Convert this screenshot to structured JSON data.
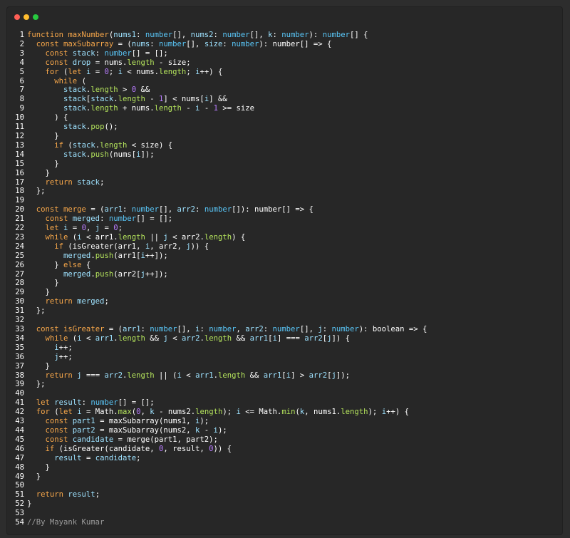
{
  "colors": {
    "background": "#2d2d2d",
    "editor_background": "#272727",
    "dot_red": "#ff5f56",
    "dot_yellow": "#ffbd2e",
    "dot_green": "#27c93f",
    "keyword": "#f7a74a",
    "type": "#59c6f7",
    "variable": "#9ee2ff",
    "number": "#b87cff",
    "property": "#b4e35c",
    "comment": "#9b9b9b",
    "plain": "#ffffff"
  },
  "window_controls": [
    "close-dot",
    "minimize-dot",
    "maximize-dot"
  ],
  "code": {
    "lines": [
      [
        [
          "kw",
          "function "
        ],
        [
          "fn",
          "maxNumber"
        ],
        [
          "p",
          "("
        ],
        [
          "var",
          "nums1"
        ],
        [
          "p",
          ": "
        ],
        [
          "ty",
          "number"
        ],
        [
          "p",
          "[], "
        ],
        [
          "var",
          "nums2"
        ],
        [
          "p",
          ": "
        ],
        [
          "ty",
          "number"
        ],
        [
          "p",
          "[], "
        ],
        [
          "var",
          "k"
        ],
        [
          "p",
          ": "
        ],
        [
          "ty",
          "number"
        ],
        [
          "p",
          "): "
        ],
        [
          "ty",
          "number"
        ],
        [
          "p",
          "[] {"
        ]
      ],
      [
        [
          "p",
          "  "
        ],
        [
          "kw",
          "const "
        ],
        [
          "fn",
          "maxSubarray"
        ],
        [
          "p",
          " = ("
        ],
        [
          "var",
          "nums"
        ],
        [
          "p",
          ": "
        ],
        [
          "ty",
          "number"
        ],
        [
          "p",
          "[], "
        ],
        [
          "var",
          "size"
        ],
        [
          "p",
          ": "
        ],
        [
          "ty",
          "number"
        ],
        [
          "p",
          "): number[] => {"
        ]
      ],
      [
        [
          "p",
          "    "
        ],
        [
          "kw",
          "const "
        ],
        [
          "var",
          "stack"
        ],
        [
          "p",
          ": "
        ],
        [
          "ty",
          "number"
        ],
        [
          "p",
          "[] = [];"
        ]
      ],
      [
        [
          "p",
          "    "
        ],
        [
          "kw",
          "const "
        ],
        [
          "var",
          "drop"
        ],
        [
          "p",
          " = nums."
        ],
        [
          "prop",
          "length"
        ],
        [
          "p",
          " - size;"
        ]
      ],
      [
        [
          "p",
          "    "
        ],
        [
          "kw",
          "for "
        ],
        [
          "p",
          "("
        ],
        [
          "kw",
          "let "
        ],
        [
          "var",
          "i"
        ],
        [
          "p",
          " = "
        ],
        [
          "num",
          "0"
        ],
        [
          "p",
          "; "
        ],
        [
          "var",
          "i"
        ],
        [
          "p",
          " < nums."
        ],
        [
          "prop",
          "length"
        ],
        [
          "p",
          "; "
        ],
        [
          "var",
          "i"
        ],
        [
          "p",
          "++) {"
        ]
      ],
      [
        [
          "p",
          "      "
        ],
        [
          "kw",
          "while "
        ],
        [
          "p",
          "("
        ]
      ],
      [
        [
          "p",
          "        "
        ],
        [
          "var",
          "stack"
        ],
        [
          "p",
          "."
        ],
        [
          "prop",
          "length"
        ],
        [
          "p",
          " > "
        ],
        [
          "num",
          "0"
        ],
        [
          "p",
          " &&"
        ]
      ],
      [
        [
          "p",
          "        "
        ],
        [
          "var",
          "stack"
        ],
        [
          "p",
          "["
        ],
        [
          "var",
          "stack"
        ],
        [
          "p",
          "."
        ],
        [
          "prop",
          "length"
        ],
        [
          "p",
          " - "
        ],
        [
          "num",
          "1"
        ],
        [
          "p",
          "] < nums["
        ],
        [
          "var",
          "i"
        ],
        [
          "p",
          "] &&"
        ]
      ],
      [
        [
          "p",
          "        "
        ],
        [
          "var",
          "stack"
        ],
        [
          "p",
          "."
        ],
        [
          "prop",
          "length"
        ],
        [
          "p",
          " + nums."
        ],
        [
          "prop",
          "length"
        ],
        [
          "p",
          " - "
        ],
        [
          "var",
          "i"
        ],
        [
          "p",
          " - "
        ],
        [
          "num",
          "1"
        ],
        [
          "p",
          " >= size"
        ]
      ],
      [
        [
          "p",
          "      ) {"
        ]
      ],
      [
        [
          "p",
          "        "
        ],
        [
          "var",
          "stack"
        ],
        [
          "p",
          "."
        ],
        [
          "mth",
          "pop"
        ],
        [
          "p",
          "();"
        ]
      ],
      [
        [
          "p",
          "      }"
        ]
      ],
      [
        [
          "p",
          "      "
        ],
        [
          "kw",
          "if "
        ],
        [
          "p",
          "("
        ],
        [
          "var",
          "stack"
        ],
        [
          "p",
          "."
        ],
        [
          "prop",
          "length"
        ],
        [
          "p",
          " < size) {"
        ]
      ],
      [
        [
          "p",
          "        "
        ],
        [
          "var",
          "stack"
        ],
        [
          "p",
          "."
        ],
        [
          "mth",
          "push"
        ],
        [
          "p",
          "(nums["
        ],
        [
          "var",
          "i"
        ],
        [
          "p",
          "]);"
        ]
      ],
      [
        [
          "p",
          "      }"
        ]
      ],
      [
        [
          "p",
          "    }"
        ]
      ],
      [
        [
          "p",
          "    "
        ],
        [
          "kw",
          "return "
        ],
        [
          "var",
          "stack"
        ],
        [
          "p",
          ";"
        ]
      ],
      [
        [
          "p",
          "  };"
        ]
      ],
      [
        [
          "p",
          ""
        ]
      ],
      [
        [
          "p",
          "  "
        ],
        [
          "kw",
          "const "
        ],
        [
          "fn",
          "merge"
        ],
        [
          "p",
          " = ("
        ],
        [
          "var",
          "arr1"
        ],
        [
          "p",
          ": "
        ],
        [
          "ty",
          "number"
        ],
        [
          "p",
          "[], "
        ],
        [
          "var",
          "arr2"
        ],
        [
          "p",
          ": "
        ],
        [
          "ty",
          "number"
        ],
        [
          "p",
          "[]): number[] => {"
        ]
      ],
      [
        [
          "p",
          "    "
        ],
        [
          "kw",
          "const "
        ],
        [
          "var",
          "merged"
        ],
        [
          "p",
          ": "
        ],
        [
          "ty",
          "number"
        ],
        [
          "p",
          "[] = [];"
        ]
      ],
      [
        [
          "p",
          "    "
        ],
        [
          "kw",
          "let "
        ],
        [
          "var",
          "i"
        ],
        [
          "p",
          " = "
        ],
        [
          "num",
          "0"
        ],
        [
          "p",
          ", "
        ],
        [
          "var",
          "j"
        ],
        [
          "p",
          " = "
        ],
        [
          "num",
          "0"
        ],
        [
          "p",
          ";"
        ]
      ],
      [
        [
          "p",
          "    "
        ],
        [
          "kw",
          "while "
        ],
        [
          "p",
          "("
        ],
        [
          "var",
          "i"
        ],
        [
          "p",
          " < arr1."
        ],
        [
          "prop",
          "length"
        ],
        [
          "p",
          " || "
        ],
        [
          "var",
          "j"
        ],
        [
          "p",
          " < arr2."
        ],
        [
          "prop",
          "length"
        ],
        [
          "p",
          ") {"
        ]
      ],
      [
        [
          "p",
          "      "
        ],
        [
          "kw",
          "if "
        ],
        [
          "p",
          "(isGreater(arr1, "
        ],
        [
          "var",
          "i"
        ],
        [
          "p",
          ", arr2, "
        ],
        [
          "var",
          "j"
        ],
        [
          "p",
          ")) {"
        ]
      ],
      [
        [
          "p",
          "        "
        ],
        [
          "var",
          "merged"
        ],
        [
          "p",
          "."
        ],
        [
          "mth",
          "push"
        ],
        [
          "p",
          "(arr1["
        ],
        [
          "var",
          "i"
        ],
        [
          "p",
          "++]);"
        ]
      ],
      [
        [
          "p",
          "      } "
        ],
        [
          "kw",
          "else "
        ],
        [
          "p",
          "{"
        ]
      ],
      [
        [
          "p",
          "        "
        ],
        [
          "var",
          "merged"
        ],
        [
          "p",
          "."
        ],
        [
          "mth",
          "push"
        ],
        [
          "p",
          "(arr2["
        ],
        [
          "var",
          "j"
        ],
        [
          "p",
          "++]);"
        ]
      ],
      [
        [
          "p",
          "      }"
        ]
      ],
      [
        [
          "p",
          "    }"
        ]
      ],
      [
        [
          "p",
          "    "
        ],
        [
          "kw",
          "return "
        ],
        [
          "var",
          "merged"
        ],
        [
          "p",
          ";"
        ]
      ],
      [
        [
          "p",
          "  };"
        ]
      ],
      [
        [
          "p",
          ""
        ]
      ],
      [
        [
          "p",
          "  "
        ],
        [
          "kw",
          "const "
        ],
        [
          "fn",
          "isGreater"
        ],
        [
          "p",
          " = ("
        ],
        [
          "var",
          "arr1"
        ],
        [
          "p",
          ": "
        ],
        [
          "ty",
          "number"
        ],
        [
          "p",
          "[], "
        ],
        [
          "var",
          "i"
        ],
        [
          "p",
          ": "
        ],
        [
          "ty",
          "number"
        ],
        [
          "p",
          ", "
        ],
        [
          "var",
          "arr2"
        ],
        [
          "p",
          ": "
        ],
        [
          "ty",
          "number"
        ],
        [
          "p",
          "[], "
        ],
        [
          "var",
          "j"
        ],
        [
          "p",
          ": "
        ],
        [
          "ty",
          "number"
        ],
        [
          "p",
          "): boolean => {"
        ]
      ],
      [
        [
          "p",
          "    "
        ],
        [
          "kw",
          "while "
        ],
        [
          "p",
          "("
        ],
        [
          "var",
          "i"
        ],
        [
          "p",
          " < "
        ],
        [
          "var",
          "arr1"
        ],
        [
          "p",
          "."
        ],
        [
          "prop",
          "length"
        ],
        [
          "p",
          " && "
        ],
        [
          "var",
          "j"
        ],
        [
          "p",
          " < "
        ],
        [
          "var",
          "arr2"
        ],
        [
          "p",
          "."
        ],
        [
          "prop",
          "length"
        ],
        [
          "p",
          " && "
        ],
        [
          "var",
          "arr1"
        ],
        [
          "p",
          "["
        ],
        [
          "var",
          "i"
        ],
        [
          "p",
          "] === "
        ],
        [
          "var",
          "arr2"
        ],
        [
          "p",
          "["
        ],
        [
          "var",
          "j"
        ],
        [
          "p",
          "]) {"
        ]
      ],
      [
        [
          "p",
          "      "
        ],
        [
          "var",
          "i"
        ],
        [
          "p",
          "++;"
        ]
      ],
      [
        [
          "p",
          "      "
        ],
        [
          "var",
          "j"
        ],
        [
          "p",
          "++;"
        ]
      ],
      [
        [
          "p",
          "    }"
        ]
      ],
      [
        [
          "p",
          "    "
        ],
        [
          "kw",
          "return "
        ],
        [
          "var",
          "j"
        ],
        [
          "p",
          " === "
        ],
        [
          "var",
          "arr2"
        ],
        [
          "p",
          "."
        ],
        [
          "prop",
          "length"
        ],
        [
          "p",
          " || ("
        ],
        [
          "var",
          "i"
        ],
        [
          "p",
          " < "
        ],
        [
          "var",
          "arr1"
        ],
        [
          "p",
          "."
        ],
        [
          "prop",
          "length"
        ],
        [
          "p",
          " && "
        ],
        [
          "var",
          "arr1"
        ],
        [
          "p",
          "["
        ],
        [
          "var",
          "i"
        ],
        [
          "p",
          "] > "
        ],
        [
          "var",
          "arr2"
        ],
        [
          "p",
          "["
        ],
        [
          "var",
          "j"
        ],
        [
          "p",
          "]);"
        ]
      ],
      [
        [
          "p",
          "  };"
        ]
      ],
      [
        [
          "p",
          ""
        ]
      ],
      [
        [
          "p",
          "  "
        ],
        [
          "kw",
          "let "
        ],
        [
          "var",
          "result"
        ],
        [
          "p",
          ": "
        ],
        [
          "ty",
          "number"
        ],
        [
          "p",
          "[] = [];"
        ]
      ],
      [
        [
          "p",
          "  "
        ],
        [
          "kw",
          "for "
        ],
        [
          "p",
          "("
        ],
        [
          "kw",
          "let "
        ],
        [
          "var",
          "i"
        ],
        [
          "p",
          " = Math."
        ],
        [
          "mth",
          "max"
        ],
        [
          "p",
          "("
        ],
        [
          "num",
          "0"
        ],
        [
          "p",
          ", "
        ],
        [
          "var",
          "k"
        ],
        [
          "p",
          " - nums2."
        ],
        [
          "prop",
          "length"
        ],
        [
          "p",
          "); "
        ],
        [
          "var",
          "i"
        ],
        [
          "p",
          " <= Math."
        ],
        [
          "mth",
          "min"
        ],
        [
          "p",
          "("
        ],
        [
          "var",
          "k"
        ],
        [
          "p",
          ", nums1."
        ],
        [
          "prop",
          "length"
        ],
        [
          "p",
          "); "
        ],
        [
          "var",
          "i"
        ],
        [
          "p",
          "++) {"
        ]
      ],
      [
        [
          "p",
          "    "
        ],
        [
          "kw",
          "const "
        ],
        [
          "var",
          "part1"
        ],
        [
          "p",
          " = maxSubarray(nums1, "
        ],
        [
          "var",
          "i"
        ],
        [
          "p",
          ");"
        ]
      ],
      [
        [
          "p",
          "    "
        ],
        [
          "kw",
          "const "
        ],
        [
          "var",
          "part2"
        ],
        [
          "p",
          " = maxSubarray(nums2, "
        ],
        [
          "var",
          "k"
        ],
        [
          "p",
          " - "
        ],
        [
          "var",
          "i"
        ],
        [
          "p",
          ");"
        ]
      ],
      [
        [
          "p",
          "    "
        ],
        [
          "kw",
          "const "
        ],
        [
          "var",
          "candidate"
        ],
        [
          "p",
          " = merge(part1, part2);"
        ]
      ],
      [
        [
          "p",
          "    "
        ],
        [
          "kw",
          "if "
        ],
        [
          "p",
          "(isGreater(candidate, "
        ],
        [
          "num",
          "0"
        ],
        [
          "p",
          ", result, "
        ],
        [
          "num",
          "0"
        ],
        [
          "p",
          ")) {"
        ]
      ],
      [
        [
          "p",
          "      "
        ],
        [
          "var",
          "result"
        ],
        [
          "p",
          " = "
        ],
        [
          "var",
          "candidate"
        ],
        [
          "p",
          ";"
        ]
      ],
      [
        [
          "p",
          "    }"
        ]
      ],
      [
        [
          "p",
          "  }"
        ]
      ],
      [
        [
          "p",
          ""
        ]
      ],
      [
        [
          "p",
          "  "
        ],
        [
          "kw",
          "return "
        ],
        [
          "var",
          "result"
        ],
        [
          "p",
          ";"
        ]
      ],
      [
        [
          "p",
          "}"
        ]
      ],
      [
        [
          "p",
          ""
        ]
      ],
      [
        [
          "cm",
          "//By Mayank Kumar"
        ]
      ]
    ]
  }
}
